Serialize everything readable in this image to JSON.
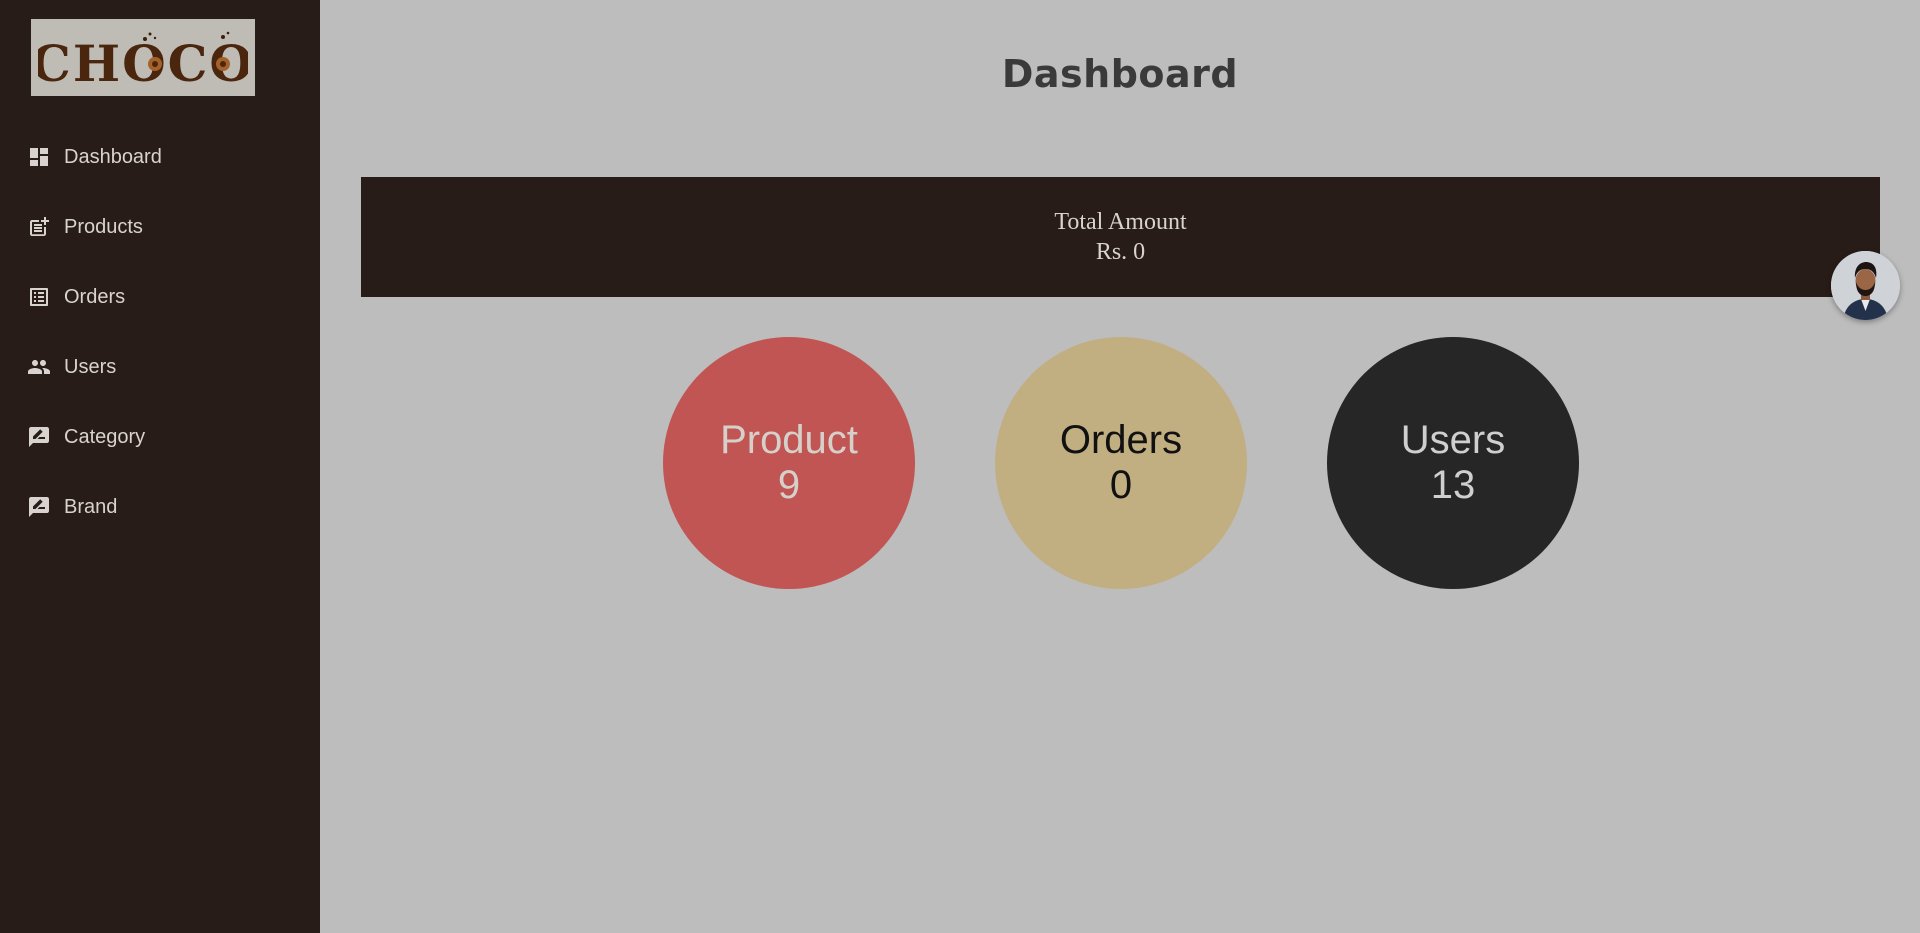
{
  "logo": {
    "text": "CHOCO"
  },
  "sidebar": {
    "items": [
      {
        "label": "Dashboard",
        "icon": "dashboard-icon"
      },
      {
        "label": "Products",
        "icon": "post-add-icon"
      },
      {
        "label": "Orders",
        "icon": "list-icon"
      },
      {
        "label": "Users",
        "icon": "people-icon"
      },
      {
        "label": "Category",
        "icon": "rate-review-icon"
      },
      {
        "label": "Brand",
        "icon": "rate-review-icon"
      }
    ]
  },
  "main": {
    "title": "Dashboard",
    "total": {
      "label": "Total Amount",
      "value": "Rs. 0"
    },
    "stats": [
      {
        "label": "Product",
        "value": "9",
        "color": "#c05553"
      },
      {
        "label": "Orders",
        "value": "0",
        "color": "#c1af82"
      },
      {
        "label": "Users",
        "value": "13",
        "color": "#262626"
      }
    ]
  },
  "avatar": {
    "icon": "user-avatar"
  },
  "colors": {
    "sidebar_bg": "#281c18",
    "page_bg": "#bdbdbd",
    "sidebar_text": "#d9d3cf"
  }
}
